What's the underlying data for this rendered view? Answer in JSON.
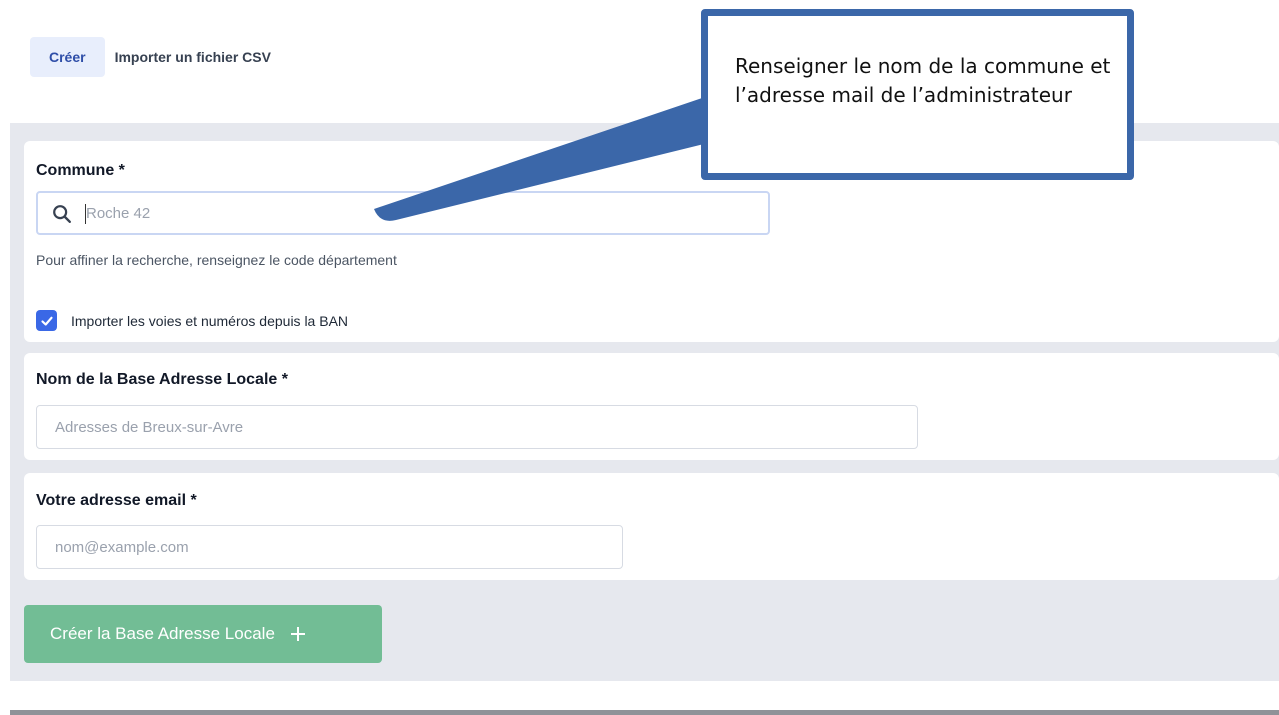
{
  "tabs": [
    {
      "label": "Créer",
      "active": true
    },
    {
      "label": "Importer un fichier CSV",
      "active": false
    }
  ],
  "form": {
    "commune": {
      "label": "Commune *",
      "placeholder": "Roche 42",
      "hint": "Pour affiner la recherche, renseignez le code département"
    },
    "import_ban": {
      "label": "Importer les voies et numéros depuis la BAN",
      "checked": true
    },
    "bal_name": {
      "label": "Nom de la Base Adresse Locale *",
      "placeholder": "Adresses de Breux-sur-Avre"
    },
    "email": {
      "label": "Votre adresse email *",
      "placeholder": "nom@example.com"
    },
    "submit": {
      "label": "Créer la Base Adresse Locale",
      "icon": "plus-icon"
    }
  },
  "callout": {
    "text": "Renseigner le nom de la commune et l’adresse mail de l’administrateur"
  },
  "colors": {
    "accent": "#3a68e6",
    "success": "#72bd95",
    "callout_border": "#3b67a9",
    "panel_bg": "#e6e8ee"
  }
}
